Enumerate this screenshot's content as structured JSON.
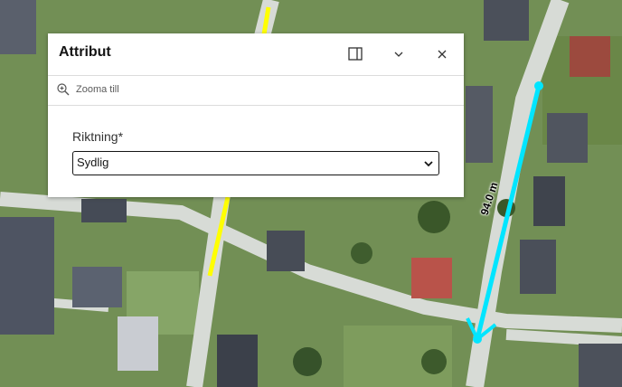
{
  "popup": {
    "title": "Attribut",
    "zoom_label": "Zooma till",
    "field_label": "Riktning*",
    "field_value": "Sydlig"
  },
  "map": {
    "measure_label": "94.0 m",
    "highlight_color": "#00e5ff",
    "road_color": "#ffff00"
  },
  "icons": {
    "dock": "dock-icon",
    "collapse": "chevron-down-icon",
    "close": "close-icon",
    "zoom": "zoom-in-icon"
  }
}
